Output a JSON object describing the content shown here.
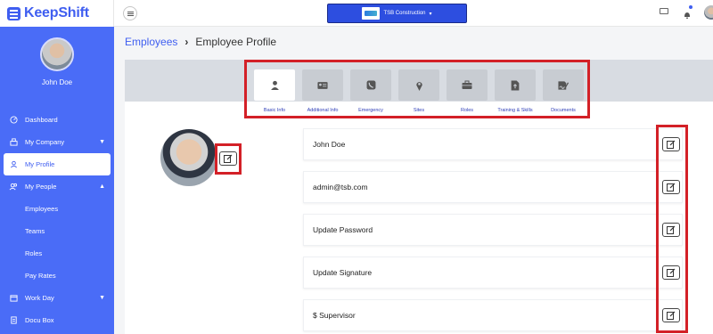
{
  "brand": {
    "name": "KeepShift"
  },
  "user": {
    "name": "John Doe"
  },
  "sidebar": {
    "items": [
      {
        "label": "Dashboard",
        "icon": "dashboard-icon"
      },
      {
        "label": "My Company",
        "icon": "company-icon",
        "expanded": false
      },
      {
        "label": "My Profile",
        "icon": "profile-icon",
        "active": true
      },
      {
        "label": "My People",
        "icon": "people-icon",
        "expanded": true
      },
      {
        "label": "Employees"
      },
      {
        "label": "Teams"
      },
      {
        "label": "Roles"
      },
      {
        "label": "Pay Rates"
      },
      {
        "label": "Work Day",
        "icon": "workday-icon",
        "expanded": false
      },
      {
        "label": "Docu Box",
        "icon": "docubox-icon"
      }
    ]
  },
  "topbar": {
    "company": "TSB Construction"
  },
  "breadcrumb": {
    "parent": "Employees",
    "current": "Employee Profile"
  },
  "tabs": [
    {
      "label": "Basic Info",
      "icon": "person-icon",
      "active": true
    },
    {
      "label": "Additional Info",
      "icon": "id-card-icon"
    },
    {
      "label": "Emergency",
      "icon": "phone-icon"
    },
    {
      "label": "Sites",
      "icon": "location-pin-icon"
    },
    {
      "label": "Roles",
      "icon": "briefcase-icon"
    },
    {
      "label": "Training & Skills",
      "icon": "upload-file-icon"
    },
    {
      "label": "Documents",
      "icon": "signature-doc-icon"
    }
  ],
  "fields": [
    {
      "value": "John Doe"
    },
    {
      "value": "admin@tsb.com"
    },
    {
      "value": "Update Password"
    },
    {
      "value": "Update Signature"
    },
    {
      "value": "$ Supervisor"
    }
  ],
  "colors": {
    "accent": "#4a6cf7",
    "highlight": "#d32027",
    "tab_label": "#2d3db8"
  }
}
